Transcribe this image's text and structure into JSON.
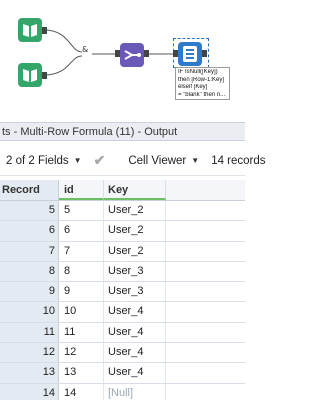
{
  "canvas": {
    "union_label": "&",
    "annotation_lines": [
      "IF IsNull([Key])",
      "then [Row-1:Key]",
      "elseif [Key]",
      "= \"blank\" then n..."
    ]
  },
  "panel": {
    "title": "ts - Multi-Row Formula (11) - Output"
  },
  "toolbar": {
    "fields_label": "2 of 2 Fields",
    "viewer_label": "Cell Viewer",
    "records_label": "14 records"
  },
  "grid": {
    "headers": {
      "record": "Record",
      "id": "id",
      "key": "Key"
    },
    "rows": [
      {
        "record": "5",
        "id": "5",
        "key": "User_2"
      },
      {
        "record": "6",
        "id": "6",
        "key": "User_2"
      },
      {
        "record": "7",
        "id": "7",
        "key": "User_2"
      },
      {
        "record": "8",
        "id": "8",
        "key": "User_3"
      },
      {
        "record": "9",
        "id": "9",
        "key": "User_3"
      },
      {
        "record": "10",
        "id": "10",
        "key": "User_4"
      },
      {
        "record": "11",
        "id": "11",
        "key": "User_4"
      },
      {
        "record": "12",
        "id": "12",
        "key": "User_4"
      },
      {
        "record": "13",
        "id": "13",
        "key": "User_4"
      },
      {
        "record": "14",
        "id": "14",
        "key": "[Null]"
      }
    ]
  },
  "colors": {
    "input_tool": "#35a66a",
    "union_tool": "#6b59b8",
    "formula_tool": "#2e7cc9",
    "selected_field_underline": "#6bbf65",
    "null_text": "#9aa6b6"
  }
}
